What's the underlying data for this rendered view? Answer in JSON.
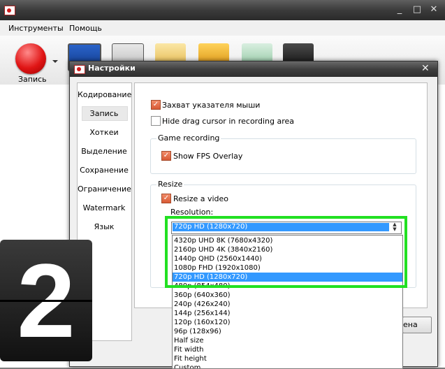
{
  "main": {
    "menu": [
      "Инструменты",
      "Помощь"
    ],
    "record_label": "Запись",
    "window_buttons": [
      "_",
      "□",
      "✕"
    ]
  },
  "dialog": {
    "title": "Настройки",
    "close": "✕",
    "nav": [
      "Кодирование",
      "Запись",
      "Хоткеи",
      "Выделение",
      "Сохранение",
      "Ограничение",
      "Watermark",
      "Язык"
    ],
    "selected_nav": "Запись",
    "capture_cursor_label": "Захват указателя мыши",
    "capture_cursor_checked": true,
    "hide_drag_label": "Hide drag cursor in recording area",
    "hide_drag_checked": false,
    "game_group_title": "Game recording",
    "fps_label": "Show FPS Overlay",
    "fps_checked": true,
    "resize_group_title": "Resize",
    "resize_label": "Resize a video",
    "resize_checked": true,
    "resolution_label": "Resolution:",
    "resolution_value": "720p HD (1280x720)",
    "resolution_options": [
      "4320p UHD 8K (7680x4320)",
      "2160p UHD 4K (3840x2160)",
      "1440p QHD (2560x1440)",
      "1080p FHD (1920x1080)",
      "720p HD (1280x720)",
      "480p (854x480)",
      "360p (640x360)",
      "240p (426x240)",
      "144p (256x144)",
      "120p (160x120)",
      "96p (128x96)",
      "Half size",
      "Fit width",
      "Fit height",
      "Custom"
    ],
    "selected_option": "720p HD (1280x720)",
    "partial_button": "ена"
  },
  "overlay": {
    "number": "2",
    "highlight_color": "#22e022"
  },
  "colors": {
    "accent_blue": "#3399ff",
    "checkbox_orange": "#d85a35",
    "record_red": "#e01515"
  }
}
